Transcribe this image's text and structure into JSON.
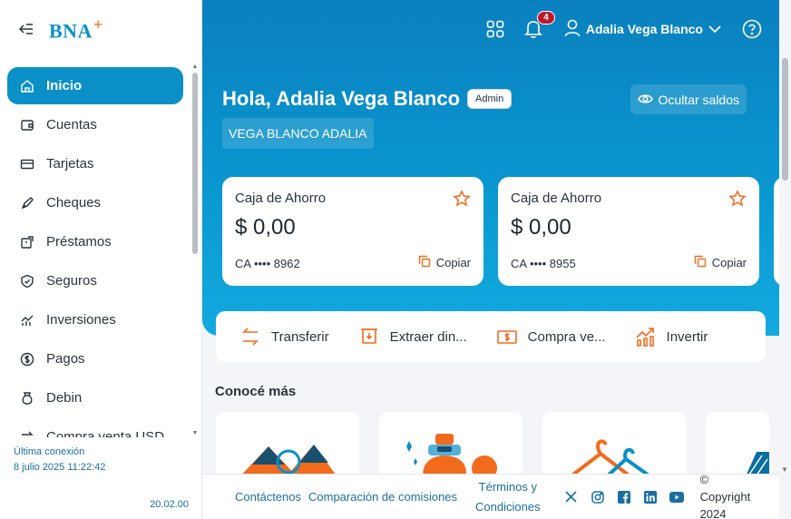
{
  "sidebar": {
    "logo": "BNA",
    "logo_plus": "+",
    "items": [
      {
        "label": "Inicio",
        "icon": "home-icon",
        "active": true
      },
      {
        "label": "Cuentas",
        "icon": "wallet-icon"
      },
      {
        "label": "Tarjetas",
        "icon": "card-icon"
      },
      {
        "label": "Cheques",
        "icon": "pen-icon"
      },
      {
        "label": "Préstamos",
        "icon": "loan-icon"
      },
      {
        "label": "Seguros",
        "icon": "shield-icon"
      },
      {
        "label": "Inversiones",
        "icon": "chart-icon"
      },
      {
        "label": "Pagos",
        "icon": "dollar-icon"
      },
      {
        "label": "Debin",
        "icon": "bag-icon"
      },
      {
        "label": "Compra venta USD",
        "icon": "exchange-icon"
      }
    ],
    "last_connection_label": "Última conexión",
    "last_connection_value": "8 julio 2025 11:22:42",
    "version": "20.02.00"
  },
  "header": {
    "notifications_count": "4",
    "user_name": "Adalia Vega Blanco"
  },
  "hero": {
    "greeting": "Hola, Adalia Vega Blanco",
    "role": "Admin",
    "hide_balances": "Ocultar saldos",
    "company": "VEGA BLANCO ADALIA"
  },
  "accounts": [
    {
      "type": "Caja de Ahorro",
      "balance": "$ 0,00",
      "number": "CA •••• 8962",
      "copy_label": "Copiar"
    },
    {
      "type": "Caja de Ahorro",
      "balance": "$ 0,00",
      "number": "CA •••• 8955",
      "copy_label": "Copiar"
    }
  ],
  "quick_actions": [
    {
      "label": "Transferir",
      "icon": "transfer-icon"
    },
    {
      "label": "Extraer din...",
      "icon": "withdraw-icon"
    },
    {
      "label": "Compra ve...",
      "icon": "cash-icon"
    },
    {
      "label": "Invertir",
      "icon": "invest-icon"
    }
  ],
  "promos_title": "Conocé más",
  "footer": {
    "contact": "Contáctenos",
    "fees": "Comparación de comisiones",
    "terms_line1": "Términos y",
    "terms_line2": "Condiciones",
    "copyright_symbol": "©",
    "copyright_word": "Copyright",
    "copyright_year": "2024"
  },
  "colors": {
    "brand": "#0a8fc7",
    "accent": "#f26b1d",
    "badge": "#c0182a"
  }
}
